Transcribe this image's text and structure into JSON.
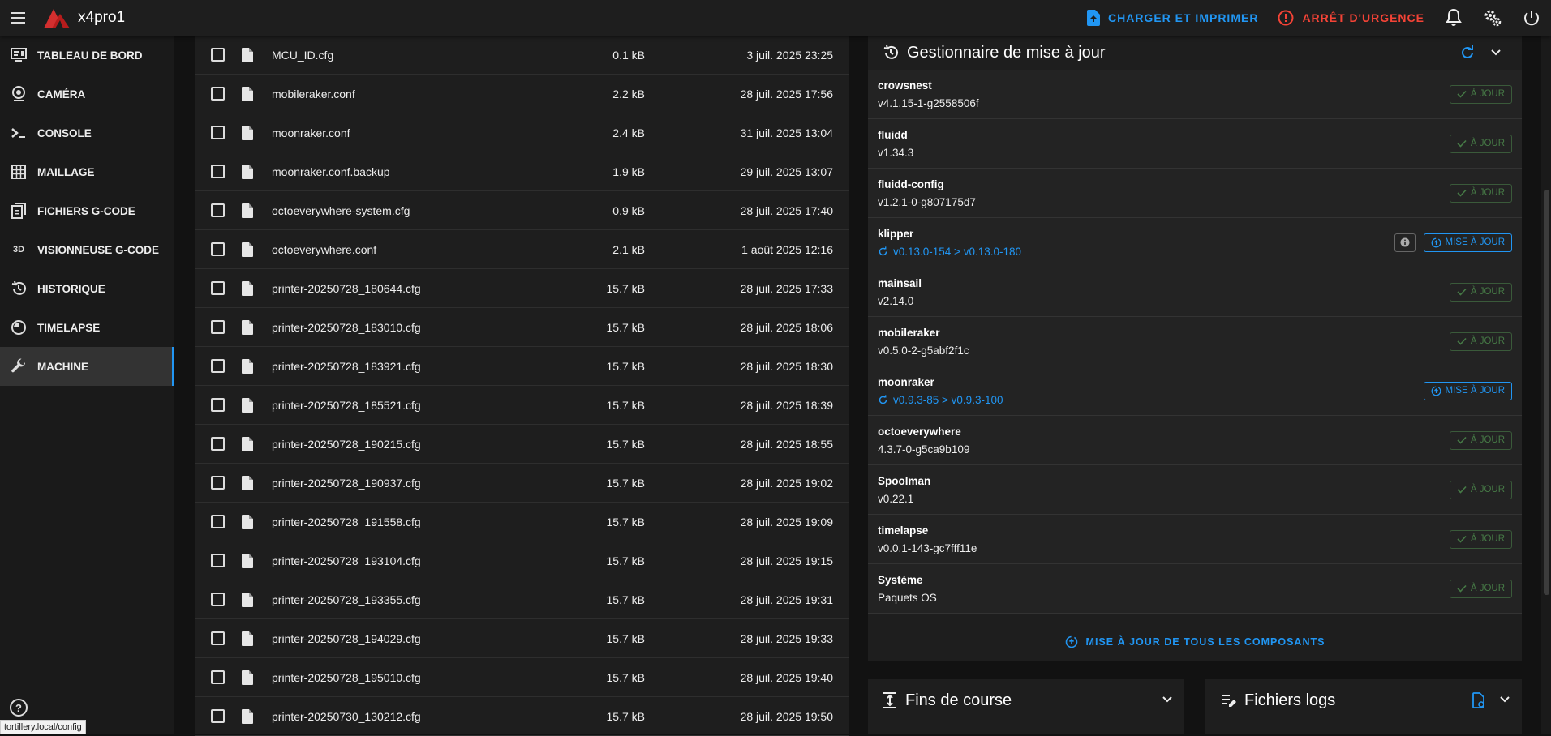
{
  "app": {
    "title": "x4pro1"
  },
  "topbar": {
    "upload_print_label": "CHARGER ET IMPRIMER",
    "emergency_stop_label": "ARRÊT D'URGENCE"
  },
  "sidebar": {
    "items": [
      {
        "label": "TABLEAU DE BORD",
        "icon": "dashboard-icon"
      },
      {
        "label": "CAMÉRA",
        "icon": "webcam-icon"
      },
      {
        "label": "CONSOLE",
        "icon": "console-icon"
      },
      {
        "label": "MAILLAGE",
        "icon": "grid-icon"
      },
      {
        "label": "FICHIERS G-CODE",
        "icon": "files-icon"
      },
      {
        "label": "VISIONNEUSE G-CODE",
        "icon": "3d-icon",
        "glyph": "3D"
      },
      {
        "label": "HISTORIQUE",
        "icon": "history-icon"
      },
      {
        "label": "TIMELAPSE",
        "icon": "timelapse-icon"
      },
      {
        "label": "MACHINE",
        "icon": "wrench-icon",
        "active": true
      }
    ],
    "help_glyph": "?",
    "status_url": "tortillery.local/config"
  },
  "files": {
    "rows": [
      {
        "name": "MCU_ID.cfg",
        "size": "0.1 kB",
        "date": "3 juil. 2025 23:25"
      },
      {
        "name": "mobileraker.conf",
        "size": "2.2 kB",
        "date": "28 juil. 2025 17:56"
      },
      {
        "name": "moonraker.conf",
        "size": "2.4 kB",
        "date": "31 juil. 2025 13:04"
      },
      {
        "name": "moonraker.conf.backup",
        "size": "1.9 kB",
        "date": "29 juil. 2025 13:07"
      },
      {
        "name": "octoeverywhere-system.cfg",
        "size": "0.9 kB",
        "date": "28 juil. 2025 17:40"
      },
      {
        "name": "octoeverywhere.conf",
        "size": "2.1 kB",
        "date": "1 août 2025 12:16"
      },
      {
        "name": "printer-20250728_180644.cfg",
        "size": "15.7 kB",
        "date": "28 juil. 2025 17:33"
      },
      {
        "name": "printer-20250728_183010.cfg",
        "size": "15.7 kB",
        "date": "28 juil. 2025 18:06"
      },
      {
        "name": "printer-20250728_183921.cfg",
        "size": "15.7 kB",
        "date": "28 juil. 2025 18:30"
      },
      {
        "name": "printer-20250728_185521.cfg",
        "size": "15.7 kB",
        "date": "28 juil. 2025 18:39"
      },
      {
        "name": "printer-20250728_190215.cfg",
        "size": "15.7 kB",
        "date": "28 juil. 2025 18:55"
      },
      {
        "name": "printer-20250728_190937.cfg",
        "size": "15.7 kB",
        "date": "28 juil. 2025 19:02"
      },
      {
        "name": "printer-20250728_191558.cfg",
        "size": "15.7 kB",
        "date": "28 juil. 2025 19:09"
      },
      {
        "name": "printer-20250728_193104.cfg",
        "size": "15.7 kB",
        "date": "28 juil. 2025 19:15"
      },
      {
        "name": "printer-20250728_193355.cfg",
        "size": "15.7 kB",
        "date": "28 juil. 2025 19:31"
      },
      {
        "name": "printer-20250728_194029.cfg",
        "size": "15.7 kB",
        "date": "28 juil. 2025 19:33"
      },
      {
        "name": "printer-20250728_195010.cfg",
        "size": "15.7 kB",
        "date": "28 juil. 2025 19:40"
      },
      {
        "name": "printer-20250730_130212.cfg",
        "size": "15.7 kB",
        "date": "28 juil. 2025 19:50"
      }
    ]
  },
  "update_manager": {
    "title": "Gestionnaire de mise à jour",
    "up_to_date_label": "À JOUR",
    "update_label": "MISE À JOUR",
    "update_all_label": "MISE À JOUR DE TOUS LES COMPOSANTS",
    "components": [
      {
        "name": "crowsnest",
        "version": "v4.1.15-1-g2558506f",
        "status": "ok"
      },
      {
        "name": "fluidd",
        "version": "v1.34.3",
        "status": "ok"
      },
      {
        "name": "fluidd-config",
        "version": "v1.2.1-0-g807175d7",
        "status": "ok"
      },
      {
        "name": "klipper",
        "version": "v0.13.0-154 > v0.13.0-180",
        "status": "update",
        "info": true
      },
      {
        "name": "mainsail",
        "version": "v2.14.0",
        "status": "ok"
      },
      {
        "name": "mobileraker",
        "version": "v0.5.0-2-g5abf2f1c",
        "status": "ok"
      },
      {
        "name": "moonraker",
        "version": "v0.9.3-85 > v0.9.3-100",
        "status": "update"
      },
      {
        "name": "octoeverywhere",
        "version": "4.3.7-0-g5ca9b109",
        "status": "ok"
      },
      {
        "name": "Spoolman",
        "version": "v0.22.1",
        "status": "ok"
      },
      {
        "name": "timelapse",
        "version": "v0.0.1-143-gc7fff11e",
        "status": "ok"
      },
      {
        "name": "Système",
        "version": "Paquets OS",
        "status": "ok"
      }
    ]
  },
  "endstops": {
    "title": "Fins de course"
  },
  "logs": {
    "title": "Fichiers logs"
  },
  "colors": {
    "accent": "#2196f3",
    "danger": "#f44336",
    "ok": "#467a46"
  }
}
